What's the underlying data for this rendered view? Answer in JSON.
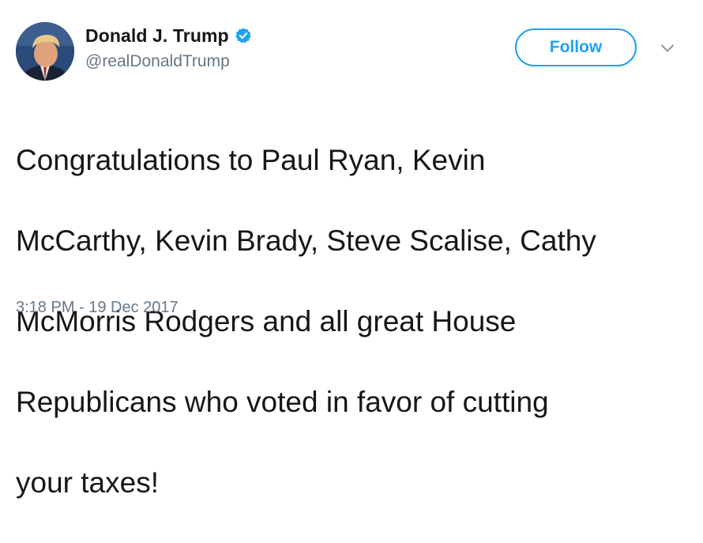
{
  "user": {
    "display_name": "Donald J. Trump",
    "handle": "@realDonaldTrump",
    "verified": true
  },
  "follow_button": {
    "label": "Follow"
  },
  "tweet": {
    "lines": [
      "Congratulations to Paul Ryan, Kevin",
      "McCarthy, Kevin Brady, Steve Scalise, Cathy",
      "McMorris Rodgers and all great House",
      "Republicans who voted in favor of cutting",
      "your taxes!"
    ],
    "timestamp": "3:18 PM - 19 Dec 2017"
  },
  "icons": {
    "verified": "verified-badge-icon",
    "caret": "chevron-down-icon"
  },
  "colors": {
    "accent": "#1da1f2",
    "text_primary": "#14171a",
    "text_secondary": "#657786"
  }
}
